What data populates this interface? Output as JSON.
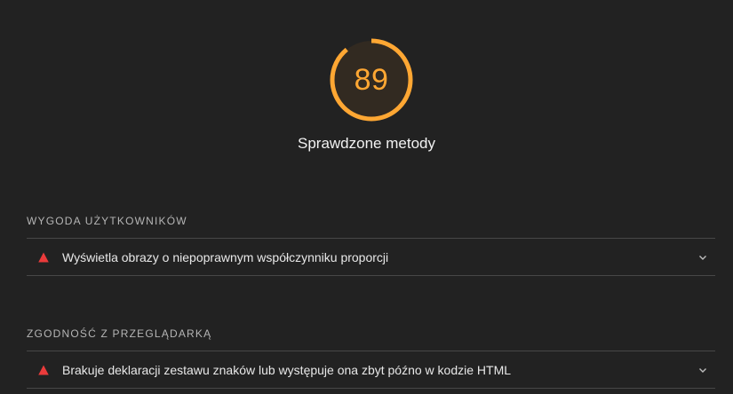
{
  "gauge": {
    "score": "89",
    "score_fraction": 0.89,
    "title": "Sprawdzone metody",
    "color": "#ffa733",
    "track_color": "#3a2e1e"
  },
  "groups": [
    {
      "title": "WYGODA UŻYTKOWNIKÓW",
      "audits": [
        {
          "title": "Wyświetla obrazy o niepoprawnym współczynniku proporcji",
          "status": "fail",
          "icon": "warning-triangle-icon"
        }
      ]
    },
    {
      "title": "ZGODNOŚĆ Z PRZEGLĄDARKĄ",
      "audits": [
        {
          "title": "Brakuje deklaracji zestawu znaków lub występuje ona zbyt późno w kodzie HTML",
          "status": "fail",
          "icon": "warning-triangle-icon"
        }
      ]
    }
  ],
  "colors": {
    "fail": "#eb3b3b",
    "background": "#222222",
    "divider": "#474747"
  }
}
